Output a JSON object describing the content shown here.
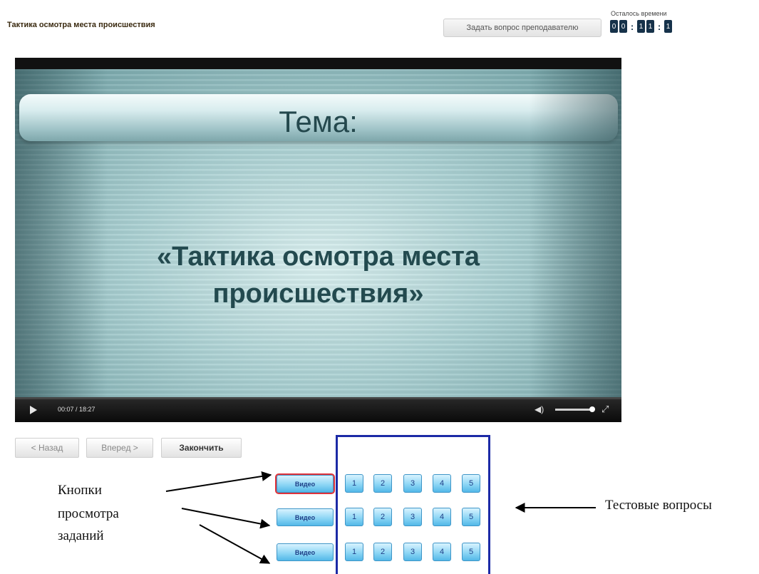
{
  "header": {
    "title": "Тактика осмотра места происшествия",
    "ask_button": "Задать вопрос преподавателю",
    "timer_label": "Осталось времени",
    "timer_digits": [
      "0",
      "0",
      "1",
      "1",
      "1"
    ],
    "timer_separator": ":"
  },
  "video": {
    "theme_label": "Тема:",
    "topic_line1": "«Тактика осмотра места",
    "topic_line2": "происшествия»",
    "time_display": "00:07 / 18:27",
    "volume_icon": "speaker-icon",
    "fullscreen_icon": "fullscreen-icon"
  },
  "nav": {
    "back": "< Назад",
    "forward": "Вперед >",
    "finish": "Закончить"
  },
  "tasks": {
    "video_label": "Видео",
    "rows": [
      {
        "video": "Видео",
        "questions": [
          "1",
          "2",
          "3",
          "4",
          "5"
        ]
      },
      {
        "video": "Видео",
        "questions": [
          "1",
          "2",
          "3",
          "4",
          "5"
        ]
      },
      {
        "video": "Видео",
        "questions": [
          "1",
          "2",
          "3",
          "4",
          "5"
        ]
      }
    ]
  },
  "annotations": {
    "left_line1": "Кнопки",
    "left_line2": "просмотра",
    "left_line3": "заданий",
    "right": "Тестовые вопросы"
  },
  "colors": {
    "box_border": "#1c2aa6",
    "active_outline": "#e0333a",
    "button_blue": "#8ed6f5"
  }
}
